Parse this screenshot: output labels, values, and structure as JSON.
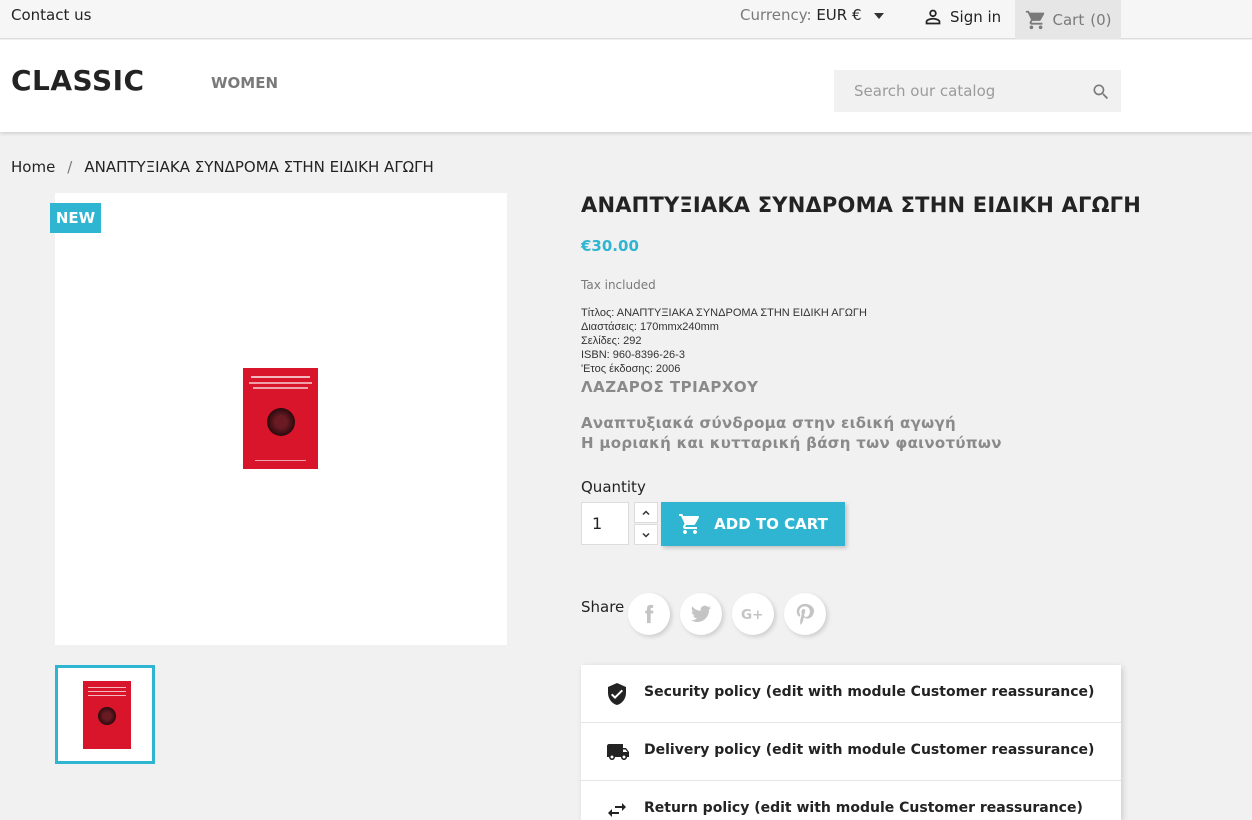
{
  "topbar": {
    "contact": "Contact us",
    "currency_label": "Currency:",
    "currency_value": "EUR €",
    "signin": "Sign in",
    "cart": "Cart",
    "cart_count": "(0)"
  },
  "header": {
    "logo": "CLASSIC",
    "menu": [
      "WOMEN"
    ],
    "search_placeholder": "Search our catalog"
  },
  "breadcrumb": {
    "home": "Home",
    "separator": "/",
    "current": "ΑΝΑΠΤΥΞΙΑΚΑ ΣΥΝΔΡΟΜΑ ΣΤΗΝ ΕΙΔΙΚΗ ΑΓΩΓΗ"
  },
  "product": {
    "badge": "NEW",
    "title": "ΑΝΑΠΤΥΞΙΑΚΑ ΣΥΝΔΡΟΜΑ ΣΤΗΝ ΕΙΔΙΚΗ ΑΓΩΓΗ",
    "price": "€30.00",
    "tax": "Tax included",
    "details": [
      "Τίτλος: ΑΝΑΠΤΥΞΙΑΚΑ ΣΥΝΔΡΟΜΑ ΣΤΗΝ ΕΙΔΙΚΗ ΑΓΩΓΗ",
      "Διαστάσεις: 170mmx240mm",
      "Σελίδες: 292",
      "ISBN: 960-8396-26-3",
      "'Ετος έκδοσης: 2006"
    ],
    "author": "ΛΑΖΑΡΟΣ ΤΡΙΑΡΧΟΥ",
    "subtitle_line1": "Αναπτυξιακά σύνδρομα στην ειδική αγωγή",
    "subtitle_line2": "Η μοριακή και κυτταρική βάση των φαινοτύπων",
    "quantity_label": "Quantity",
    "quantity_value": "1",
    "add_to_cart": "ADD TO CART",
    "share_label": "Share"
  },
  "reassurance": [
    {
      "icon": "shield-check-icon",
      "text": "Security policy (edit with module Customer reassurance)"
    },
    {
      "icon": "truck-icon",
      "text": "Delivery policy (edit with module Customer reassurance)"
    },
    {
      "icon": "swap-arrows-icon",
      "text": "Return policy (edit with module Customer reassurance)"
    }
  ],
  "colors": {
    "accent": "#2fb5d2",
    "cover": "#d8152a"
  }
}
